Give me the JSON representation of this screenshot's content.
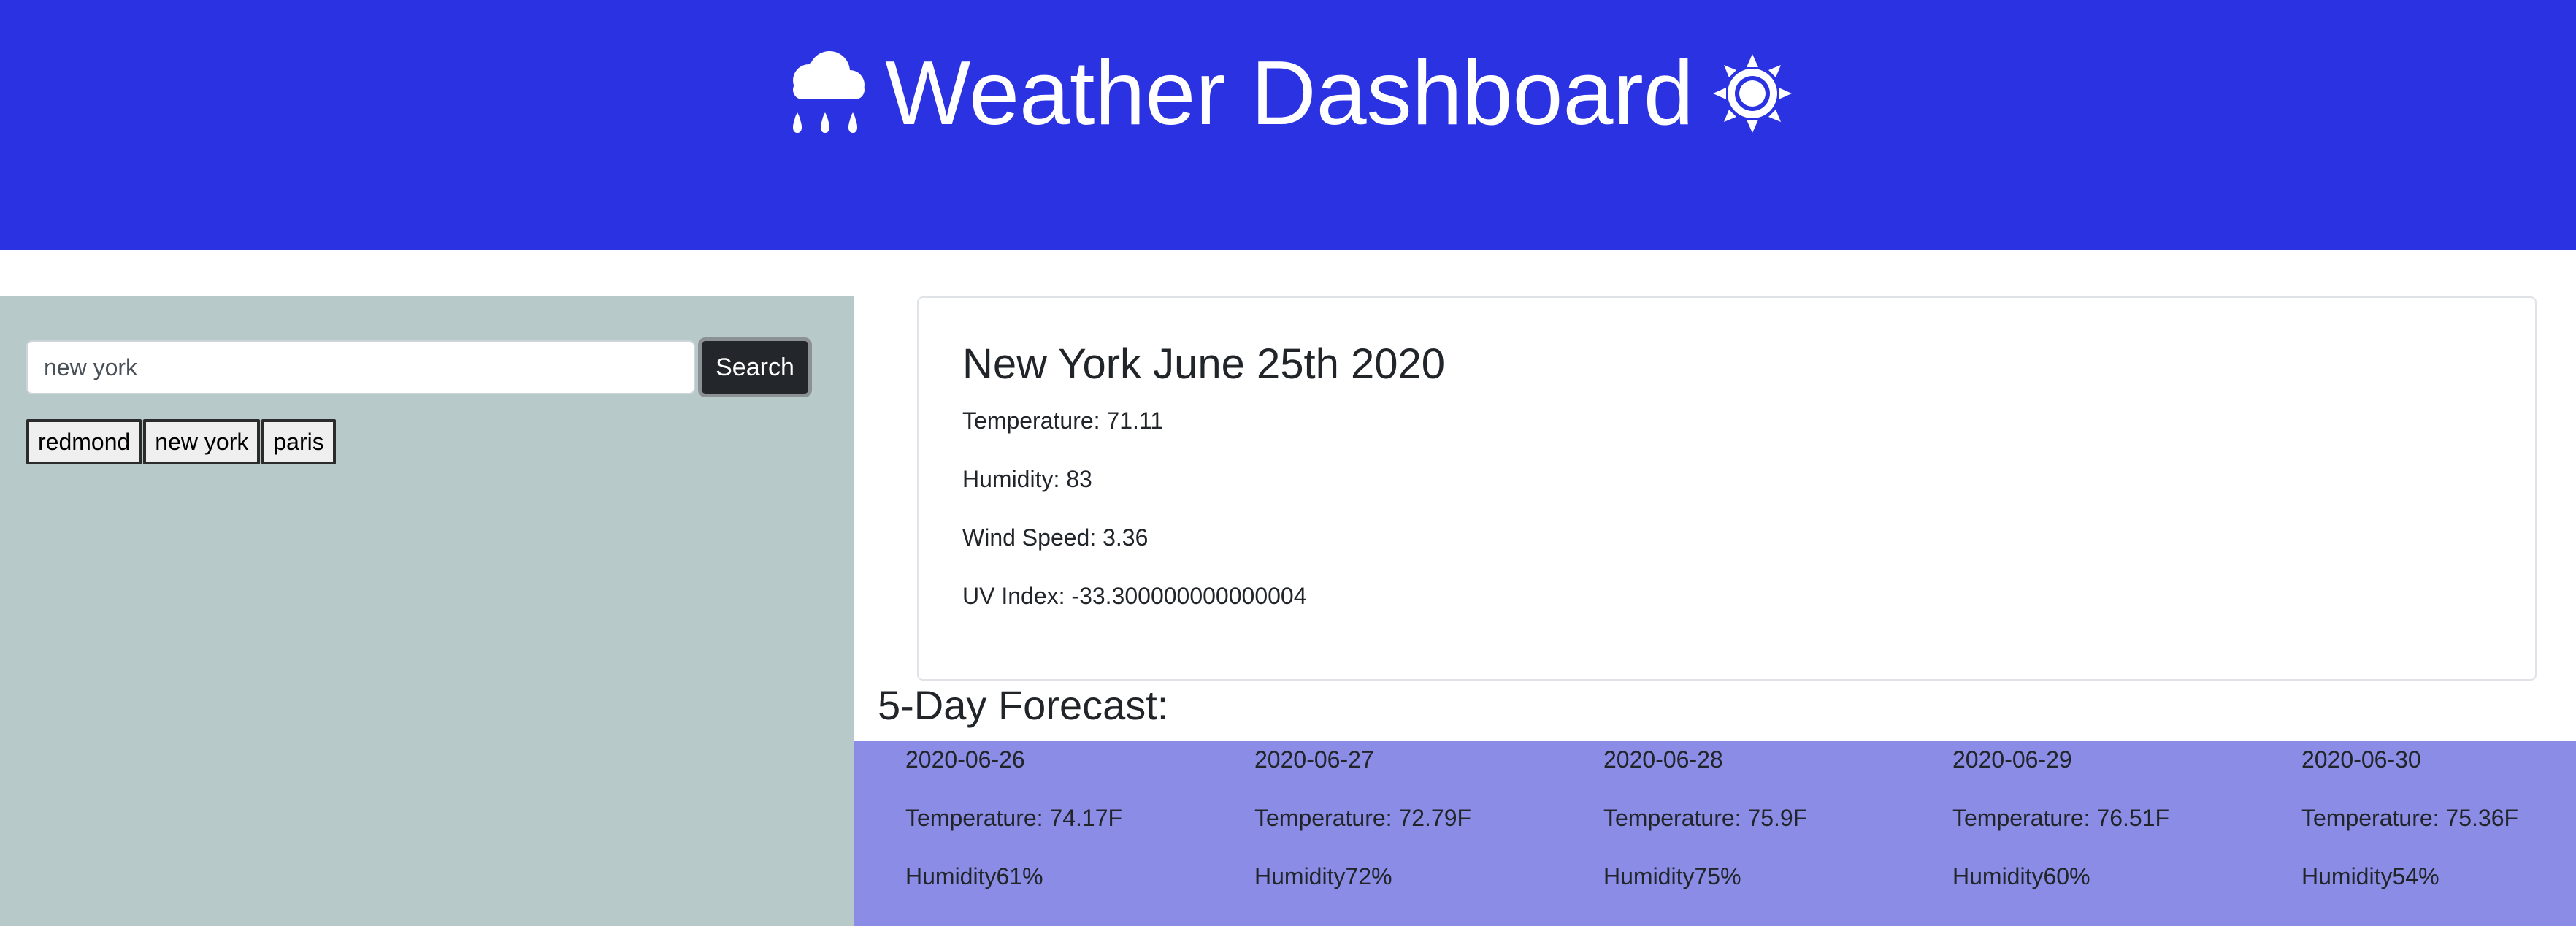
{
  "header": {
    "title": "Weather Dashboard",
    "left_icon": "cloud-rain-icon",
    "right_icon": "sun-icon"
  },
  "colors": {
    "header_bg": "#2a32e2",
    "sidebar_bg": "#b8c9c9",
    "forecast_bg": "#8a8ce6",
    "search_button_bg": "#23272b"
  },
  "search": {
    "value": "new york",
    "button_label": "Search"
  },
  "history": [
    "redmond",
    "new york",
    "paris"
  ],
  "current": {
    "title": "New York June 25th 2020",
    "temperature": "Temperature: 71.11",
    "humidity": "Humidity: 83",
    "wind_speed": "Wind Speed: 3.36",
    "uv_index": "UV Index: -33.300000000000004"
  },
  "forecast": {
    "heading": "5-Day Forecast:",
    "days": [
      {
        "date": "2020-06-26",
        "temperature": "Temperature: 74.17F",
        "humidity": "Humidity61%"
      },
      {
        "date": "2020-06-27",
        "temperature": "Temperature: 72.79F",
        "humidity": "Humidity72%"
      },
      {
        "date": "2020-06-28",
        "temperature": "Temperature: 75.9F",
        "humidity": "Humidity75%"
      },
      {
        "date": "2020-06-29",
        "temperature": "Temperature: 76.51F",
        "humidity": "Humidity60%"
      },
      {
        "date": "2020-06-30",
        "temperature": "Temperature: 75.36F",
        "humidity": "Humidity54%"
      }
    ]
  }
}
